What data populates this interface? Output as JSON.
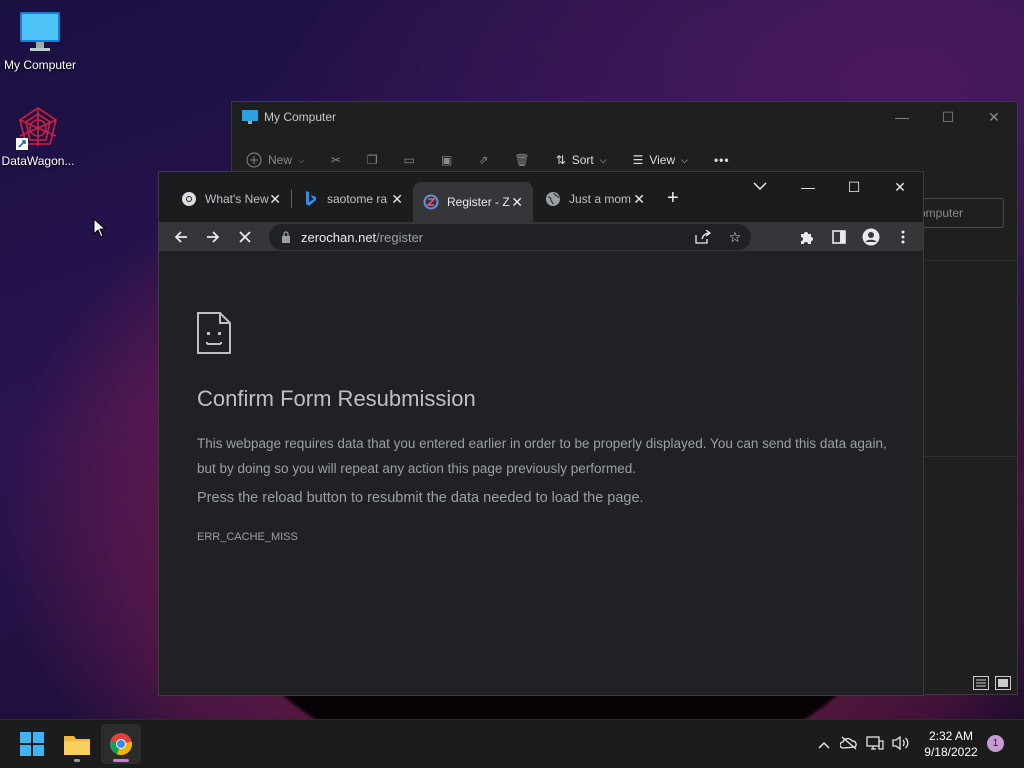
{
  "desktop": {
    "icons": [
      {
        "label": "My Computer"
      },
      {
        "label": "DataWagon..."
      }
    ]
  },
  "explorer": {
    "title": "My Computer",
    "toolbar": {
      "new_label": "New",
      "sort_label": "Sort",
      "view_label": "View",
      "more_label": "•••"
    },
    "search_placeholder": "omputer"
  },
  "chrome": {
    "tabs": [
      {
        "label": "What's New",
        "favicon": "chrome-icon"
      },
      {
        "label": "saotome ra",
        "favicon": "bing-icon"
      },
      {
        "label": "Register - Z",
        "favicon": "zerochan-icon",
        "active": true
      },
      {
        "label": "Just a mom",
        "favicon": "globe-icon"
      }
    ],
    "new_tab_label": "+",
    "url": {
      "host": "zerochan.net",
      "path": "/register"
    },
    "page": {
      "title": "Confirm Form Resubmission",
      "body": "This webpage requires data that you entered earlier in order to be properly displayed. You can send this data again, but by doing so you will repeat any action this page previously performed.",
      "reload_hint": "Press the reload button to resubmit the data needed to load the page.",
      "error_code": "ERR_CACHE_MISS"
    }
  },
  "taskbar": {
    "clock_time": "2:32 AM",
    "clock_date": "9/18/2022",
    "notification_count": "1"
  }
}
